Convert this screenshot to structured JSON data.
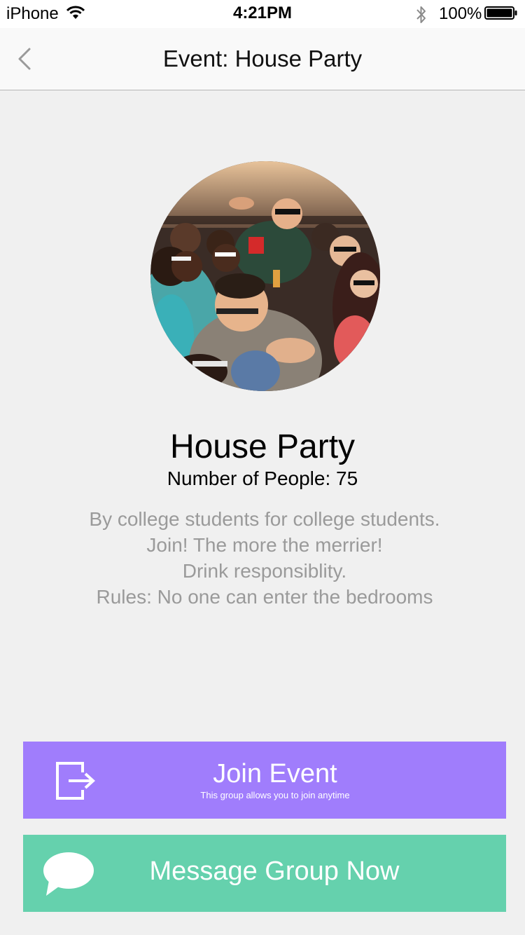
{
  "status_bar": {
    "carrier": "iPhone",
    "time": "4:21PM",
    "battery": "100%"
  },
  "nav": {
    "title": "Event: House Party"
  },
  "event": {
    "name": "House Party",
    "people_count": "Number of People: 75",
    "description": [
      "By college students for college students.",
      "Join! The more the merrier!",
      "Drink responsiblity.",
      "Rules: No one can enter the bedrooms"
    ]
  },
  "actions": {
    "join_label": "Join Event",
    "join_sublabel": "This group allows you to join anytime",
    "message_label": "Message Group Now"
  },
  "colors": {
    "join_button": "#a07dfc",
    "message_button": "#65d1ad",
    "background": "#f0f0f0"
  }
}
